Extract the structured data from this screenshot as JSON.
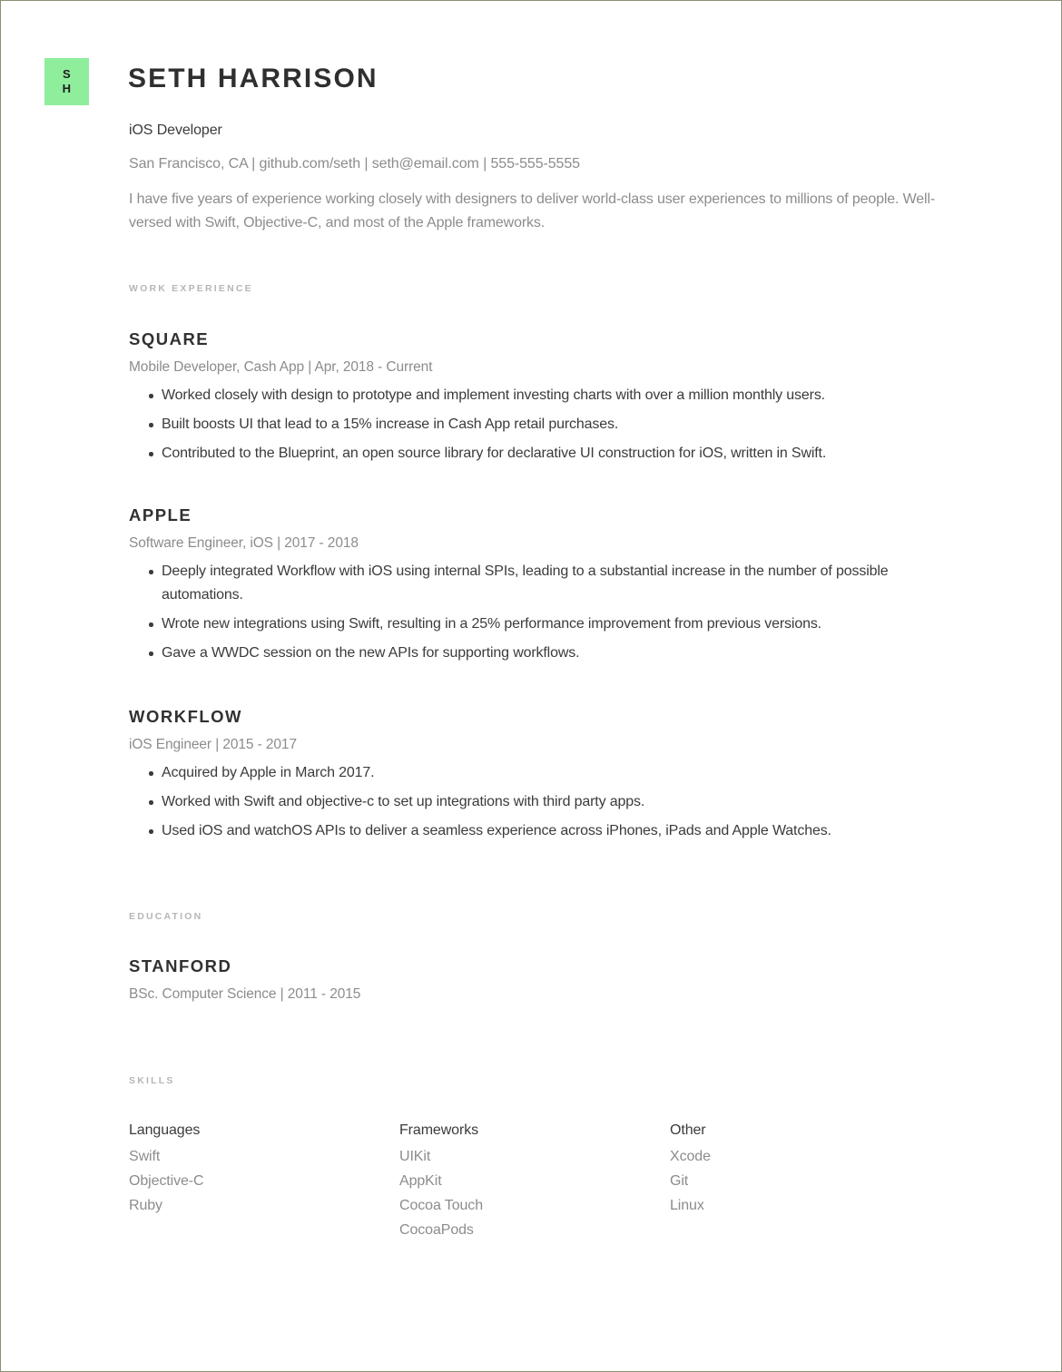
{
  "theme": {
    "accent": "#8eee9c",
    "text_dark": "#3b3b3b",
    "text_muted": "#8c8c8c",
    "label_gray": "#b6b6b6",
    "page_border": "#8b9175"
  },
  "header": {
    "badge_initial_1": "S",
    "badge_initial_2": "H",
    "name": "SETH HARRISON",
    "role": "iOS Developer",
    "contact": "San Francisco, CA | github.com/seth | seth@email.com | 555-555-5555",
    "summary": "I have five years of experience working closely with designers to deliver world-class user experiences to millions of people. Well-versed with Swift, Objective-C, and most of the Apple frameworks."
  },
  "sections": {
    "work_label": "WORK EXPERIENCE",
    "education_label": "EDUCATION",
    "skills_label": "SKILLS"
  },
  "work": [
    {
      "company": "SQUARE",
      "meta": "Mobile Developer, Cash App | Apr, 2018 - Current",
      "bullets": [
        "Worked closely with design to prototype and implement investing charts with over a million monthly users.",
        "Built boosts UI that lead to a 15% increase in Cash App retail purchases.",
        "Contributed to the Blueprint, an open source library for declarative UI construction for iOS, written in Swift."
      ]
    },
    {
      "company": "APPLE",
      "meta": "Software Engineer, iOS | 2017 - 2018",
      "bullets": [
        "Deeply integrated Workflow with iOS using internal SPIs, leading to a substantial increase in the number of possible automations.",
        "Wrote new integrations using Swift, resulting in a 25% performance improvement from previous versions.",
        "Gave a WWDC session on the new APIs for supporting workflows."
      ]
    },
    {
      "company": "WORKFLOW",
      "meta": "iOS Engineer | 2015 - 2017",
      "bullets": [
        "Acquired by Apple in March 2017.",
        "Worked with Swift and objective-c to set up integrations with third party apps.",
        "Used iOS and watchOS APIs to deliver a seamless experience across iPhones, iPads and Apple Watches."
      ]
    }
  ],
  "education": [
    {
      "school": "STANFORD",
      "meta": "BSc. Computer Science | 2011 - 2015"
    }
  ],
  "skills": [
    {
      "title": "Languages",
      "items": [
        "Swift",
        "Objective-C",
        "Ruby"
      ]
    },
    {
      "title": "Frameworks",
      "items": [
        "UIKit",
        "AppKit",
        "Cocoa Touch",
        "CocoaPods"
      ]
    },
    {
      "title": "Other",
      "items": [
        "Xcode",
        "Git",
        "Linux"
      ]
    }
  ]
}
